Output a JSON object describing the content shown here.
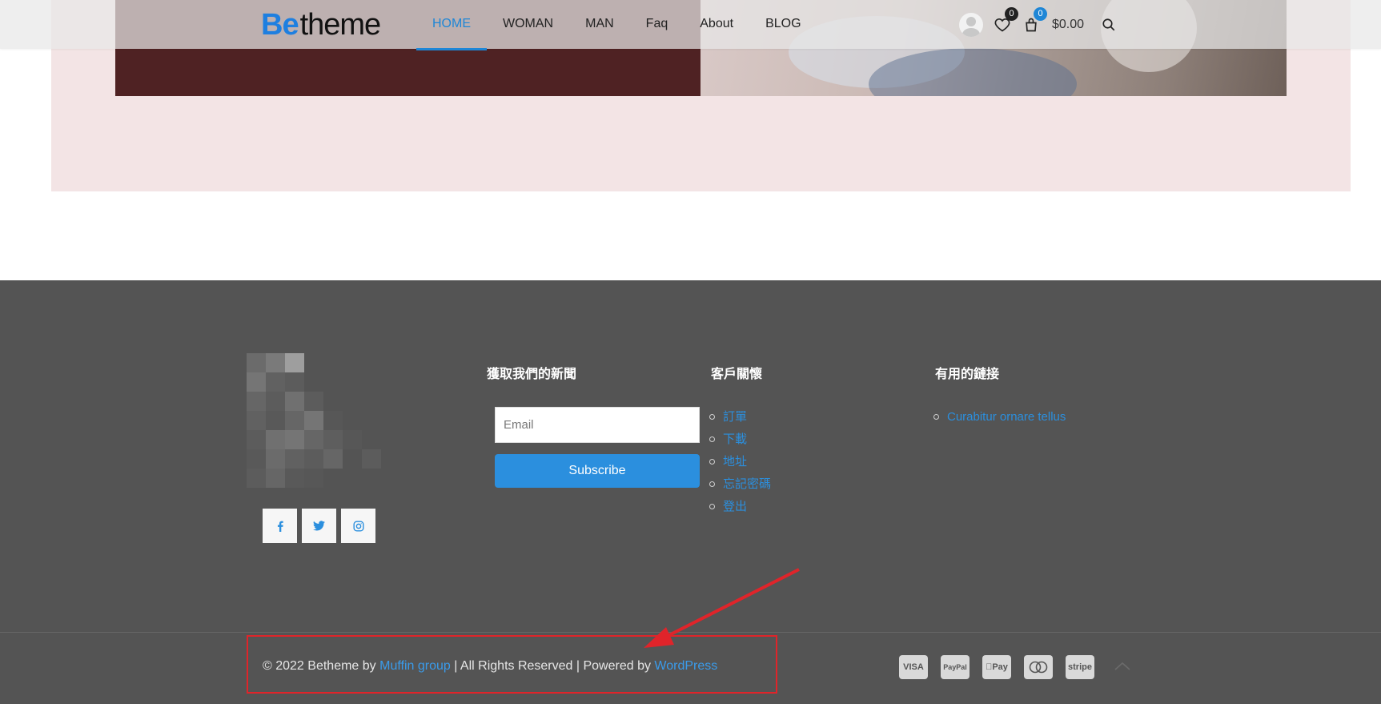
{
  "header": {
    "logo_be": "Be",
    "logo_theme": "theme",
    "nav": [
      {
        "label": "HOME",
        "active": true
      },
      {
        "label": "WOMAN",
        "active": false
      },
      {
        "label": "MAN",
        "active": false
      },
      {
        "label": "Faq",
        "active": false
      },
      {
        "label": "About",
        "active": false
      },
      {
        "label": "BLOG",
        "active": false
      }
    ],
    "wishlist_count": "0",
    "cart_count": "0",
    "cart_total": "$0.00",
    "icons": [
      "user-avatar-icon",
      "heart-icon",
      "bag-icon",
      "search-icon"
    ]
  },
  "footer": {
    "social": [
      {
        "name": "facebook-icon",
        "glyph": "f"
      },
      {
        "name": "twitter-icon",
        "glyph": "t"
      },
      {
        "name": "instagram-icon",
        "glyph": "ig"
      }
    ],
    "newsletter": {
      "title": "獲取我們的新聞",
      "email_placeholder": "Email",
      "subscribe_label": "Subscribe"
    },
    "customer_care": {
      "title": "客戶關懷",
      "links": [
        "訂單",
        "下載",
        "地址",
        "忘記密碼",
        "登出"
      ]
    },
    "useful_links": {
      "title": "有用的鏈接",
      "links": [
        "Curabitur ornare tellus"
      ]
    },
    "copyright": {
      "prefix": "© 2022 Betheme by ",
      "author": "Muffin group",
      "middle": " | All Rights Reserved | Powered by ",
      "platform": "WordPress"
    },
    "payments": [
      "VISA",
      "PayPal",
      "Pay",
      "mastercard",
      "stripe"
    ]
  },
  "colors": {
    "accent": "#1e86d6",
    "footer_bg": "#545454",
    "hero_bg": "#f3e4e5",
    "highlight": "#e0242a"
  }
}
